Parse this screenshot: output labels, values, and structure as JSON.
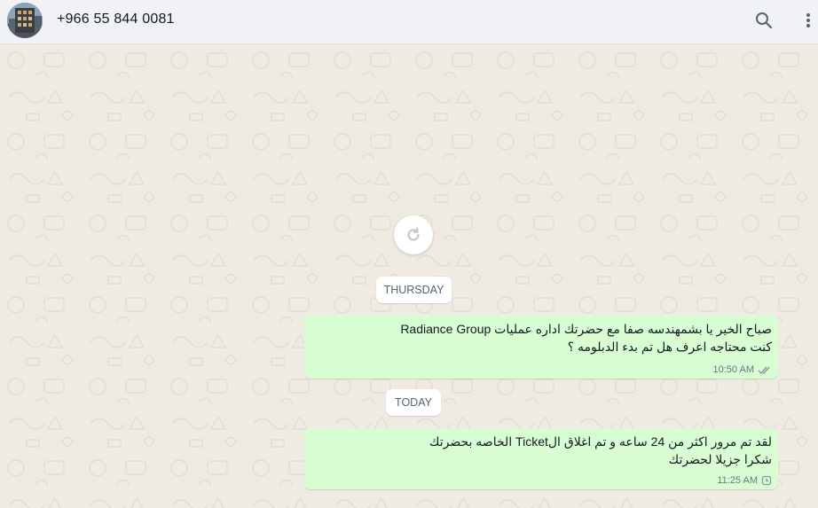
{
  "header": {
    "contact_name": "+966 55 844 0081",
    "search_icon": "search-icon",
    "menu_icon": "more-vertical-icon"
  },
  "chat": {
    "background": "#efeae2",
    "refresh_icon": "refresh-icon",
    "messages": [
      {
        "date_chip": "THURSDAY",
        "lines": [
          "صباح الخير يا بشمهندسه صفا مع حضرتك اداره عمليات Radiance Group",
          "كنت محتاجه اعرف هل تم بدء الدبلومه ؟"
        ],
        "time": "10:50 AM",
        "status_icon": "double-check-icon"
      },
      {
        "date_chip": "TODAY",
        "lines": [
          "لقد تم مرور اكثر من 24 ساعه و تم اغلاق الTicket الخاصه بحضرتك",
          "شكرا جزيلا لحضرتك"
        ],
        "time": "11:25 AM",
        "status_icon": "clock-icon"
      }
    ]
  },
  "colors": {
    "header_bg": "#f0f2f5",
    "outgoing_bubble": "#d9fdd3",
    "meta_text": "#667781"
  }
}
